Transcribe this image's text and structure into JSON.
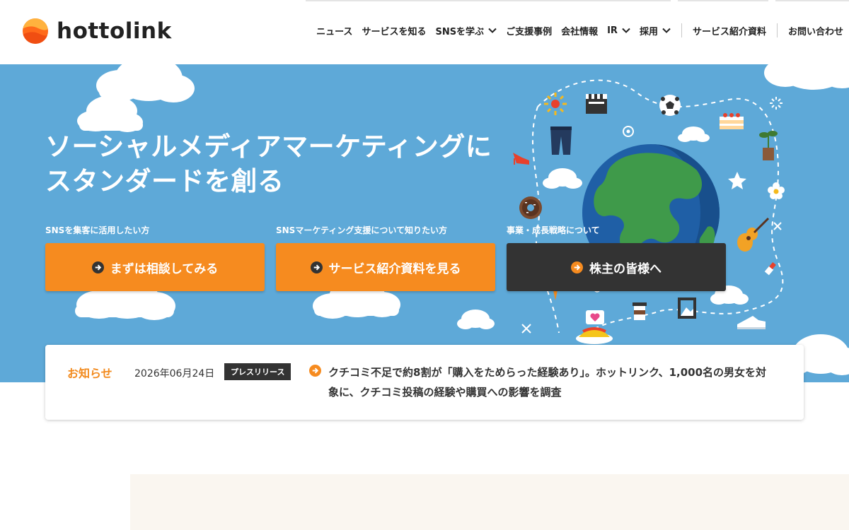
{
  "brand": {
    "name": "hottolink"
  },
  "nav": {
    "items": [
      {
        "label": "ニュース",
        "dropdown": false
      },
      {
        "label": "サービスを知る",
        "dropdown": false
      },
      {
        "label": "SNSを学ぶ",
        "dropdown": true
      },
      {
        "label": "ご支援事例",
        "dropdown": false
      },
      {
        "label": "会社情報",
        "dropdown": false
      },
      {
        "label": "IR",
        "dropdown": true
      },
      {
        "label": "採用",
        "dropdown": true
      }
    ],
    "materials": "サービス紹介資料",
    "contact": "お問い合わせ"
  },
  "hero": {
    "title_line1": "ソーシャルメディアマーケティングに",
    "title_line2": "スタンダードを創る",
    "ctas": [
      {
        "caption": "SNSを集客に活用したい方",
        "label": "まずは相談してみる",
        "color": "#f68b1f"
      },
      {
        "caption": "SNSマーケティング支援について知りたい方",
        "label": "サービス紹介資料を見る",
        "color": "#f68b1f"
      },
      {
        "caption": "事業・成長戦略について",
        "label": "株主の皆様へ",
        "color": "#333333"
      }
    ]
  },
  "news": {
    "heading": "お知らせ",
    "date": "2026年06月24日",
    "category": "プレスリリース",
    "title_line1": "クチコミ不足で約8割が「購入をためらった経験あり」。ホットリンク、1,000名の男女を対",
    "title_line2": "象に、クチコミ投稿の経験や購買への影響を調査"
  },
  "colors": {
    "accent": "#f68b1f",
    "hero_bg": "#5ea9d8",
    "dark_button": "#333333",
    "news_heading": "#f28a1d"
  },
  "icons": [
    "logo-mark",
    "chevron-down-icon",
    "arrow-circle-icon",
    "globe-illustration"
  ]
}
